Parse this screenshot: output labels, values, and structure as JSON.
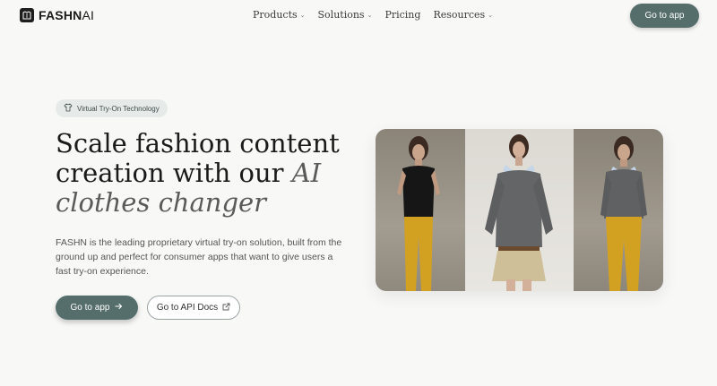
{
  "brand": {
    "name_bold": "FASHN",
    "name_light": "AI"
  },
  "nav": {
    "items": [
      {
        "label": "Products",
        "has_dropdown": true
      },
      {
        "label": "Solutions",
        "has_dropdown": true
      },
      {
        "label": "Pricing",
        "has_dropdown": false
      },
      {
        "label": "Resources",
        "has_dropdown": true
      }
    ],
    "cta_label": "Go to app"
  },
  "hero": {
    "badge": "Virtual Try-On Technology",
    "headline_plain": "Scale fashion content creation with our",
    "headline_italic": "AI clothes changer",
    "description": "FASHN is the leading proprietary virtual try-on solution, built from the ground up and perfect for consumer apps that want to give users a fast try-on experience.",
    "primary_cta": "Go to app",
    "secondary_cta": "Go to API Docs",
    "image_panels": [
      {
        "subject": "model in black t-shirt and yellow jeans"
      },
      {
        "subject": "model in grey sweater and beige skirt"
      },
      {
        "subject": "model in grey sweater and yellow jeans"
      }
    ]
  },
  "colors": {
    "accent": "#556e6c",
    "background": "#f8f8f7",
    "badge_bg": "#e6ebea"
  },
  "icons": [
    "logo-icon",
    "chevron-down-icon",
    "shirt-icon",
    "arrow-right-icon",
    "external-link-icon"
  ]
}
